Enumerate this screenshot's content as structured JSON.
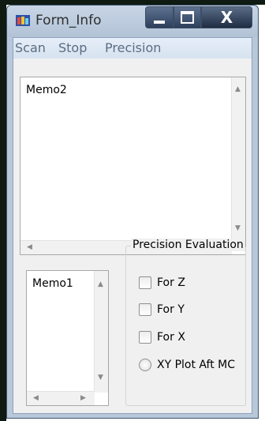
{
  "window": {
    "title": "Form_Info",
    "close_glyph": "X"
  },
  "menu": {
    "items": [
      "Scan",
      "Stop",
      "Precision"
    ]
  },
  "memo2": {
    "text": "Memo2"
  },
  "memo1": {
    "text": "Memo1"
  },
  "group": {
    "caption": "Precision Evaluation",
    "options": [
      {
        "label": "For Z",
        "type": "checkbox",
        "checked": false
      },
      {
        "label": "For Y",
        "type": "checkbox",
        "checked": false
      },
      {
        "label": "For X",
        "type": "checkbox",
        "checked": false
      },
      {
        "label": "XY Plot Aft MC",
        "type": "radio",
        "checked": false
      }
    ]
  },
  "icons": {
    "app": "app-icon",
    "scroll_up": "▲",
    "scroll_down": "▼",
    "scroll_left": "◀",
    "scroll_right": "▶"
  }
}
